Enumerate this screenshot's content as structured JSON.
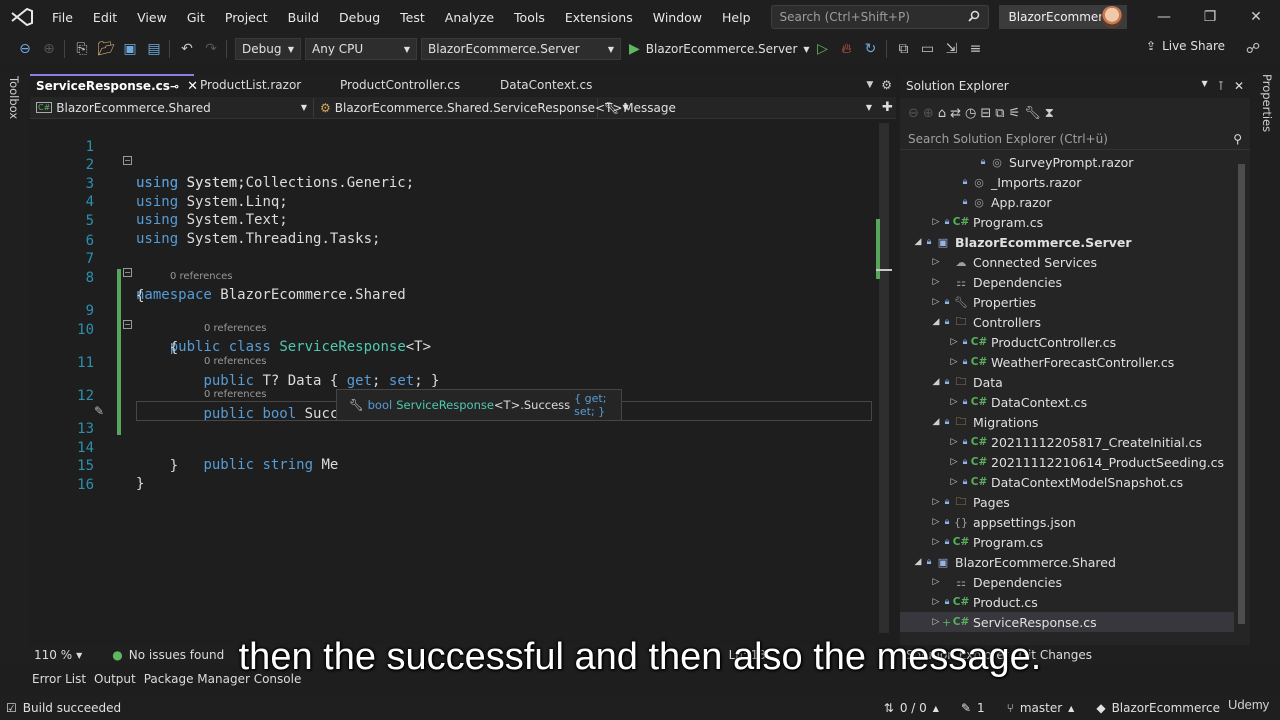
{
  "menu": [
    "File",
    "Edit",
    "View",
    "Git",
    "Project",
    "Build",
    "Debug",
    "Test",
    "Analyze",
    "Tools",
    "Extensions",
    "Window",
    "Help"
  ],
  "search": {
    "placeholder": "Search (Ctrl+Shift+P)"
  },
  "solution_name": "BlazorEcommerce",
  "toolbar": {
    "config": "Debug",
    "platform": "Any CPU",
    "startup_project": "BlazorEcommerce.Server",
    "run_label": "BlazorEcommerce.Server",
    "live_share": "Live Share"
  },
  "side_strips": {
    "toolbox": "Toolbox",
    "properties": "Properties"
  },
  "tabs": [
    {
      "label": "ServiceResponse.cs",
      "active": true
    },
    {
      "label": "ProductList.razor",
      "active": false
    },
    {
      "label": "ProductController.cs",
      "active": false
    },
    {
      "label": "DataContext.cs",
      "active": false
    }
  ],
  "navbar": {
    "project": "BlazorEcommerce.Shared",
    "type": "BlazorEcommerce.Shared.ServiceResponse<T>",
    "member": "Message"
  },
  "code": {
    "line_numbers": [
      "1",
      "2",
      "3",
      "4",
      "5",
      "6",
      "7",
      "8",
      "9",
      "10",
      "11",
      "12",
      "13",
      "14",
      "15",
      "16"
    ],
    "codelens": "0 references",
    "quickinfo_type": "bool",
    "quickinfo_class": "ServiceResponse",
    "quickinfo_member": "<T>.Success",
    "quickinfo_accessors": "{ get; set; }"
  },
  "editor_status": {
    "zoom": "110 %",
    "issues": "No issues found",
    "position": "Ln: 13"
  },
  "bottom_tabs": [
    "Error List",
    "Output",
    "Package Manager Console"
  ],
  "solution_explorer": {
    "title": "Solution Explorer",
    "search_placeholder": "Search Solution Explorer (Ctrl+ü)",
    "footer_tabs": [
      "Solution Explorer",
      "Git Changes"
    ],
    "tree": [
      {
        "label": "SurveyPrompt.razor",
        "icon": "razor"
      },
      {
        "label": "_Imports.razor",
        "icon": "razor"
      },
      {
        "label": "App.razor",
        "icon": "razor"
      },
      {
        "label": "Program.cs",
        "icon": "cs"
      },
      {
        "label": "BlazorEcommerce.Server",
        "icon": "project"
      },
      {
        "label": "Connected Services",
        "icon": "connected"
      },
      {
        "label": "Dependencies",
        "icon": "dependencies"
      },
      {
        "label": "Properties",
        "icon": "properties"
      },
      {
        "label": "Controllers",
        "icon": "folder"
      },
      {
        "label": "ProductController.cs",
        "icon": "cs"
      },
      {
        "label": "WeatherForecastController.cs",
        "icon": "cs"
      },
      {
        "label": "Data",
        "icon": "folder"
      },
      {
        "label": "DataContext.cs",
        "icon": "cs"
      },
      {
        "label": "Migrations",
        "icon": "folder"
      },
      {
        "label": "20211112205817_CreateInitial.cs",
        "icon": "cs"
      },
      {
        "label": "20211112210614_ProductSeeding.cs",
        "icon": "cs"
      },
      {
        "label": "DataContextModelSnapshot.cs",
        "icon": "cs"
      },
      {
        "label": "Pages",
        "icon": "folder"
      },
      {
        "label": "appsettings.json",
        "icon": "json"
      },
      {
        "label": "Program.cs",
        "icon": "cs"
      },
      {
        "label": "BlazorEcommerce.Shared",
        "icon": "project"
      },
      {
        "label": "Dependencies",
        "icon": "dependencies"
      },
      {
        "label": "Product.cs",
        "icon": "cs"
      },
      {
        "label": "ServiceResponse.cs",
        "icon": "cs"
      }
    ]
  },
  "statusbar": {
    "build": "Build succeeded",
    "changes": "0 / 0",
    "pending": "1",
    "branch": "master",
    "repo": "BlazorEcommerce"
  },
  "caption": "then the successful and then also the message.",
  "watermark": "Udemy",
  "colors": {
    "accent": "#8b7de8",
    "keyword": "#569cd6",
    "type": "#4ec9b0",
    "change_bar": "#58a55c",
    "line_number": "#2b91af"
  }
}
